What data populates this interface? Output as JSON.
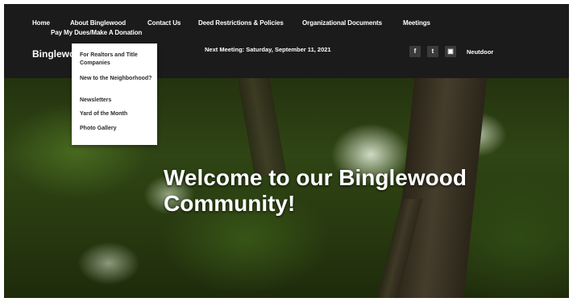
{
  "nav": {
    "items": [
      {
        "label": "Home"
      },
      {
        "label": "About Binglewood"
      },
      {
        "label": "Contact Us"
      },
      {
        "label": "Deed Restrictions & Policies"
      },
      {
        "label": "Organizational Documents"
      },
      {
        "label": "Meetings"
      }
    ],
    "second_row": {
      "label": "Pay My Dues/Make A Donation"
    }
  },
  "brand": {
    "name": "Binglewood"
  },
  "next_meeting": {
    "text": "Next Meeting: Saturday, September 11, 2021"
  },
  "social": {
    "icons": [
      "facebook-icon",
      "twitter-icon",
      "instagram-icon"
    ],
    "labels": [
      "f",
      "t",
      "▣"
    ]
  },
  "member_link": {
    "label": "Neutdoor"
  },
  "dropdown": {
    "items": [
      {
        "label": "For Realtors and Title Companies"
      },
      {
        "label": "New to the Neighborhood?"
      },
      {
        "label": "Newsletters"
      },
      {
        "label": "Yard of the Month"
      },
      {
        "label": "Photo Gallery"
      }
    ]
  },
  "hero": {
    "title": "Welcome to our Binglewood Community!"
  },
  "colors": {
    "header_bg": "#1b1b1b",
    "dropdown_bg": "#ffffff",
    "hero_text": "#ffffff"
  }
}
